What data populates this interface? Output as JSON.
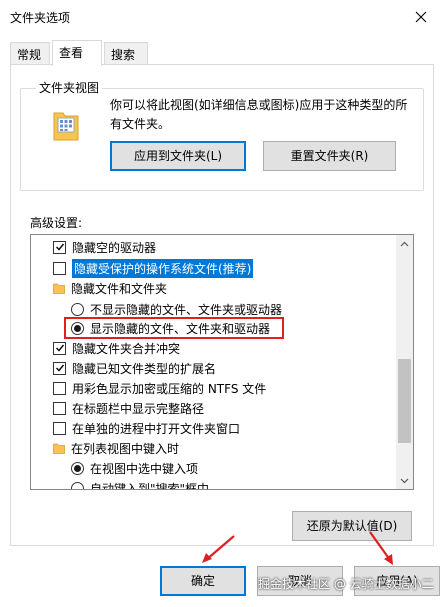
{
  "window": {
    "title": "文件夹选项",
    "close_icon": "close-icon"
  },
  "tabs": [
    {
      "label": "常规",
      "active": false
    },
    {
      "label": "查看",
      "active": true
    },
    {
      "label": "搜索",
      "active": false
    }
  ],
  "folder_view": {
    "legend": "文件夹视图",
    "description": "你可以将此视图(如详细信息或图标)应用于这种类型的所有文件夹。",
    "apply_button": "应用到文件夹(L)",
    "reset_button": "重置文件夹(R)"
  },
  "advanced": {
    "label": "高级设置:",
    "items": [
      {
        "type": "checkbox",
        "checked": true,
        "label": "隐藏空的驱动器"
      },
      {
        "type": "checkbox",
        "checked": false,
        "label": "隐藏受保护的操作系统文件(推荐)",
        "selected": true
      },
      {
        "type": "folder",
        "label": "隐藏文件和文件夹"
      },
      {
        "type": "radio",
        "checked": false,
        "label": "不显示隐藏的文件、文件夹或驱动器"
      },
      {
        "type": "radio",
        "checked": true,
        "label": "显示隐藏的文件、文件夹和驱动器"
      },
      {
        "type": "checkbox",
        "checked": true,
        "label": "隐藏文件夹合并冲突"
      },
      {
        "type": "checkbox",
        "checked": true,
        "label": "隐藏已知文件类型的扩展名"
      },
      {
        "type": "checkbox",
        "checked": false,
        "label": "用彩色显示加密或压缩的 NTFS 文件"
      },
      {
        "type": "checkbox",
        "checked": false,
        "label": "在标题栏中显示完整路径"
      },
      {
        "type": "checkbox",
        "checked": false,
        "label": "在单独的进程中打开文件夹窗口"
      },
      {
        "type": "folder",
        "label": "在列表视图中键入时"
      },
      {
        "type": "radio",
        "checked": true,
        "label": "在视图中选中键入项"
      },
      {
        "type": "radio",
        "checked": false,
        "label": "自动键入到\"搜索\"框中"
      }
    ],
    "restore_button": "还原为默认值(D)"
  },
  "footer": {
    "ok_button": "确定",
    "cancel_button": "取消",
    "apply_button": "应用(A)"
  },
  "watermark": "掘金技术社区 @ 云骑士数据小二",
  "colors": {
    "highlight": "#0078d7",
    "annotation_red": "#e02020"
  }
}
